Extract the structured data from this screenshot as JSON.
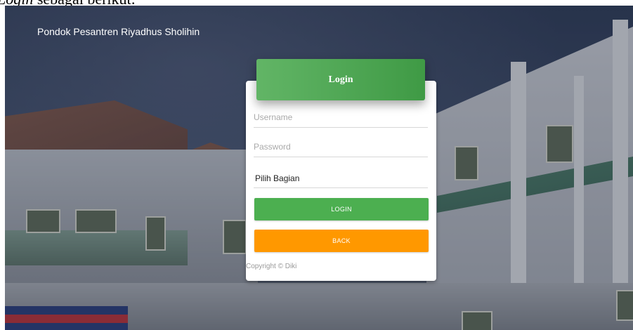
{
  "document": {
    "caption_italic": "Login",
    "caption_rest": " sebagai berikut:"
  },
  "header": {
    "site_title": "Pondok Pesantren Riyadhus Sholihin"
  },
  "login_card": {
    "title": "Login",
    "username": {
      "value": "",
      "placeholder": "Username"
    },
    "password": {
      "value": "",
      "placeholder": "Password"
    },
    "bagian_select": {
      "selected": "Pilih Bagian"
    },
    "login_button": "LOGIN",
    "back_button": "BACK",
    "copyright": "Copyright © Diki"
  },
  "colors": {
    "header_green": "#4caf50",
    "login_button": "#4caf50",
    "back_button": "#ff9800",
    "card": "#ffffff"
  }
}
